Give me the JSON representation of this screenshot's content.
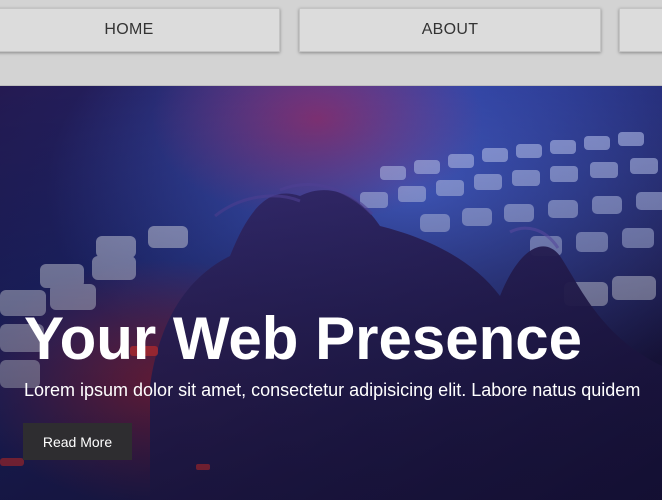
{
  "nav": {
    "items": [
      {
        "label": "HOME"
      },
      {
        "label": "ABOUT"
      },
      {
        "label": ""
      }
    ]
  },
  "hero": {
    "title": "Your Web Presence",
    "subtitle": "Lorem ipsum dolor sit amet, consectetur adipisicing elit. Labore natus quidem",
    "button_label": "Read More",
    "image_icon": "keyboard-hands-photo",
    "colors": {
      "overlay": "#1b1640",
      "text": "#ffffff",
      "button_bg": "#2e2d30"
    }
  },
  "colors": {
    "nav_bg": "#d3d3d3",
    "nav_item_bg": "#dcdcdc",
    "nav_text": "#333333"
  }
}
